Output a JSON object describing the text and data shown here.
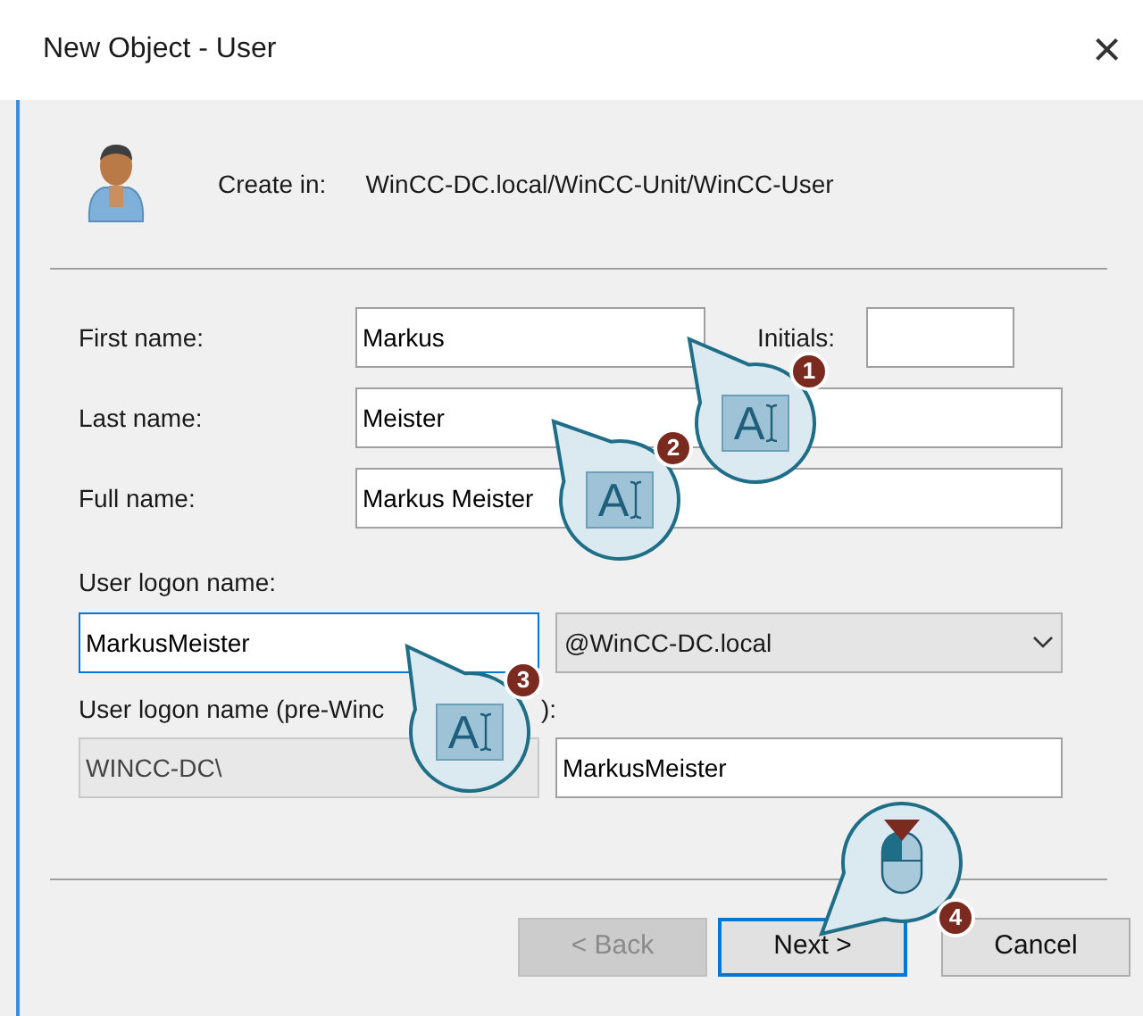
{
  "window": {
    "title": "New Object - User",
    "close": "×"
  },
  "create_in": {
    "label": "Create in:",
    "path": "WinCC-DC.local/WinCC-Unit/WinCC-User"
  },
  "fields": {
    "first_name": {
      "label": "First name:",
      "value": "Markus"
    },
    "initials": {
      "label": "Initials:"
    },
    "last_name": {
      "label": "Last name:",
      "value": "Meister"
    },
    "full_name": {
      "label": "Full name:",
      "value": "Markus Meister"
    },
    "logon": {
      "label": "User logon name:",
      "value": "MarkusMeister",
      "focused": true,
      "domain": "@WinCC-DC.local"
    },
    "pre_windows": {
      "label_start": "User logon name (pre-Winc",
      "label_end": "):",
      "domain": "WINCC-DC\\",
      "domain_disabled": true,
      "value": "MarkusMeister"
    }
  },
  "buttons": [
    {
      "label": "< Back",
      "disabled": true,
      "default": false
    },
    {
      "label": "Next >",
      "disabled": false,
      "default": true
    },
    {
      "label": "Cancel",
      "disabled": false,
      "default": false
    }
  ],
  "callouts": [
    {
      "kind": "text-cursor",
      "glyph": "A",
      "number": "1"
    },
    {
      "kind": "text-cursor",
      "glyph": "A",
      "number": "2"
    },
    {
      "kind": "text-cursor",
      "glyph": "A",
      "number": "3"
    },
    {
      "kind": "mouse",
      "number": "4"
    }
  ]
}
